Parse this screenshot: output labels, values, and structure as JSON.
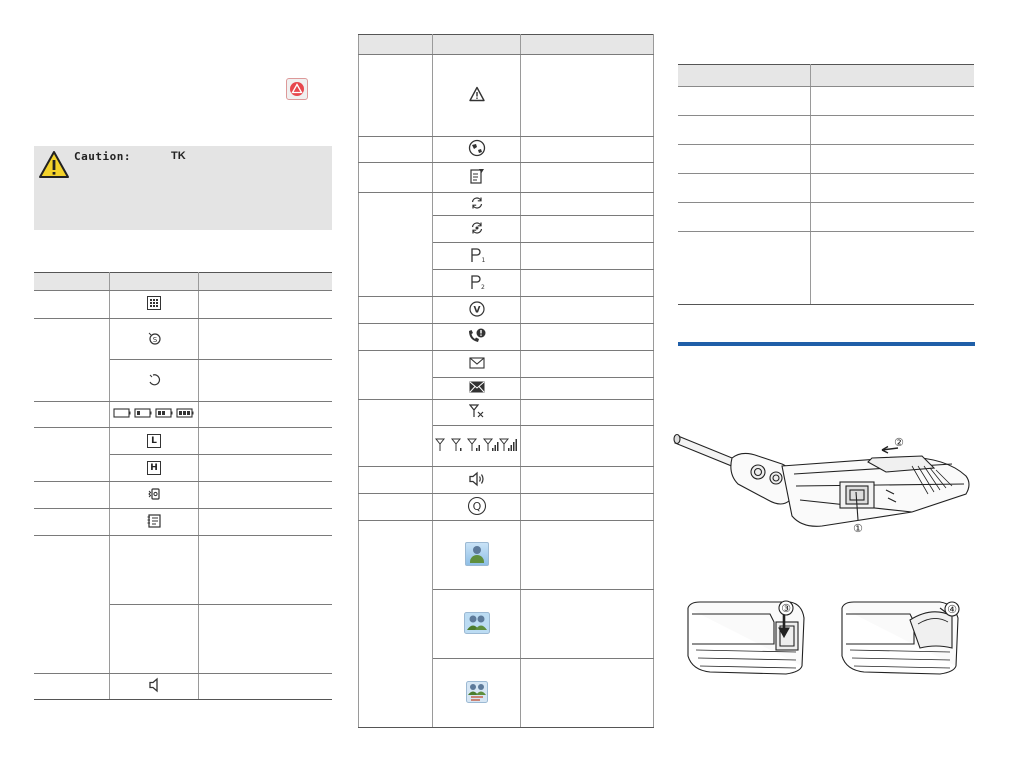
{
  "caution": {
    "label": "Caution:",
    "brand": "TK"
  },
  "icons": {
    "warning_icon_color": "#e7474d",
    "caution_icon_color": "#f3d22a",
    "section_rule_color": "#1f5fa8",
    "digits": {
      "q": "Q",
      "l": "L",
      "h": "H",
      "p1": "1",
      "p2": "2",
      "v": "V"
    }
  },
  "figure": {
    "callouts": [
      "①",
      "②",
      "③",
      "④"
    ]
  }
}
